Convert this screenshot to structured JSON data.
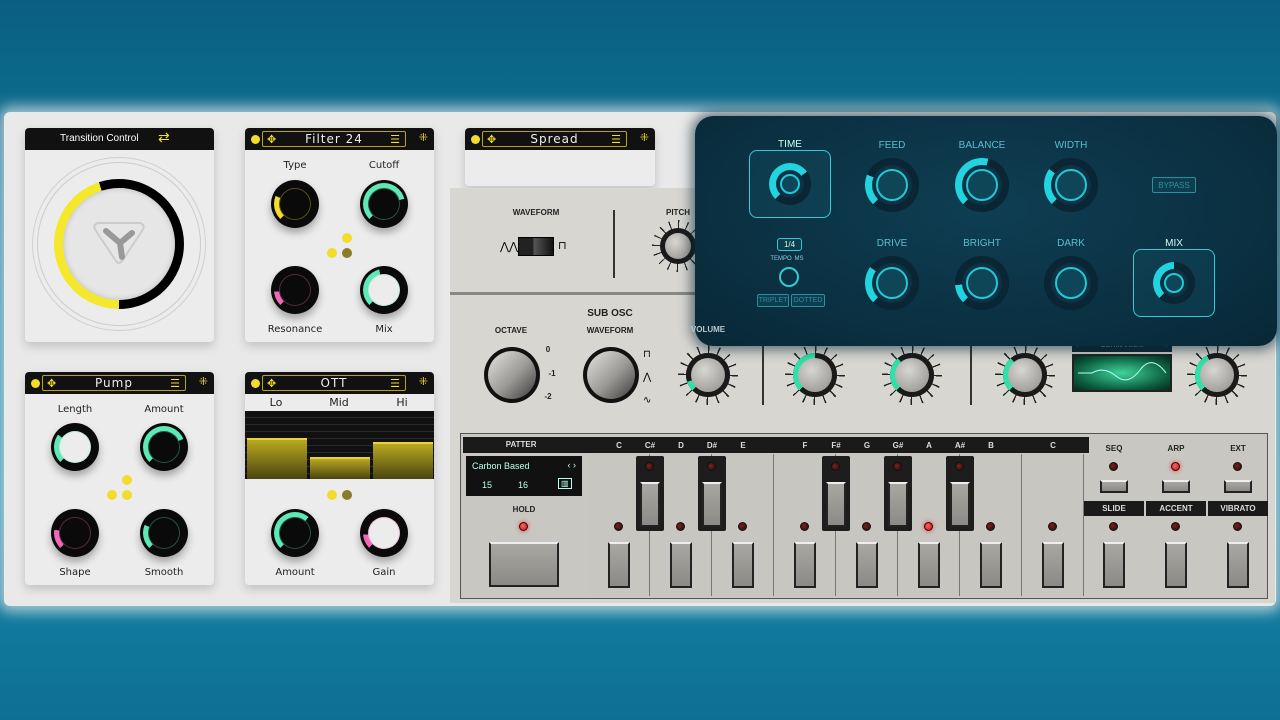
{
  "transition": {
    "title": "Transition Control",
    "value": 0.45,
    "accent": "#f3e82b"
  },
  "filter": {
    "title": "Filter 24",
    "knobs": [
      {
        "label": "Type",
        "value": 0.25,
        "color": "#f3dc2b"
      },
      {
        "label": "Cutoff",
        "value": 0.78,
        "color": "#5ee8b5"
      },
      {
        "label": "Resonance",
        "value": 0.15,
        "color": "#f06ab8"
      },
      {
        "label": "Mix",
        "value": 0.45,
        "color": "#5ee8b5"
      }
    ]
  },
  "spread": {
    "title": "Spread"
  },
  "pump": {
    "title": "Pump",
    "knobs": [
      {
        "label": "Length",
        "value": 0.3,
        "color": "#5ee8b5"
      },
      {
        "label": "Amount",
        "value": 0.75,
        "color": "#5ee8b5"
      },
      {
        "label": "Shape",
        "value": 0.2,
        "color": "#f06ab8"
      },
      {
        "label": "Smooth",
        "value": 0.25,
        "color": "#5ee8b5"
      }
    ]
  },
  "ott": {
    "title": "OTT",
    "bands": [
      {
        "label": "Lo",
        "level": 0.6
      },
      {
        "label": "Mid",
        "level": 0.33
      },
      {
        "label": "Hi",
        "level": 0.55
      }
    ],
    "knobs": [
      {
        "label": "Amount",
        "value": 0.65,
        "color": "#5ee8b5"
      },
      {
        "label": "Gain",
        "value": 0.15,
        "color": "#f06ab8"
      }
    ]
  },
  "delay": {
    "time": {
      "label": "TIME",
      "value": 0.7
    },
    "division": "1/4",
    "tempo": "TEMPO",
    "ms": "MS",
    "triplet": "TRIPLET",
    "dotted": "DOTTED",
    "bypass": "BYPASS",
    "knobs": [
      {
        "label": "FEED",
        "value": 0.25
      },
      {
        "label": "BALANCE",
        "value": 0.55
      },
      {
        "label": "WIDTH",
        "value": 0.3
      },
      {
        "label": "DRIVE",
        "value": 0.3
      },
      {
        "label": "BRIGHT",
        "value": 0.15
      },
      {
        "label": "DARK",
        "value": 0.0
      }
    ],
    "mix": {
      "label": "MIX",
      "value": 0.5
    },
    "accent": "#22d3e0"
  },
  "synth": {
    "waveform": "WAVEFORM",
    "pitch": "PITCH",
    "sub_osc": "SUB OSC",
    "octave": "OCTAVE",
    "sub_waveform": "WAVEFORM",
    "volume": "VOLUME",
    "octave_marks": [
      "0",
      "-1",
      "-2"
    ],
    "distortion": "GERMANIUM",
    "knobs": [
      {
        "value": 0.55
      },
      {
        "value": 0.1
      },
      {
        "value": 0.5
      },
      {
        "value": 0.35
      },
      {
        "value": 0.4
      }
    ]
  },
  "pattern": {
    "title": "PATTERN",
    "name": "Carbon Based",
    "steps": "15",
    "length": "16",
    "hold": "HOLD",
    "notes": [
      "C",
      "C#",
      "D",
      "D#",
      "E",
      "F",
      "F#",
      "G",
      "G#",
      "A",
      "A#",
      "B",
      "C"
    ],
    "active_note": "A",
    "modes": [
      {
        "label": "SEQ",
        "on": false
      },
      {
        "label": "ARP",
        "on": true
      },
      {
        "label": "EXT",
        "on": false
      }
    ],
    "mods": [
      "SLIDE",
      "ACCENT",
      "VIBRATO"
    ]
  }
}
